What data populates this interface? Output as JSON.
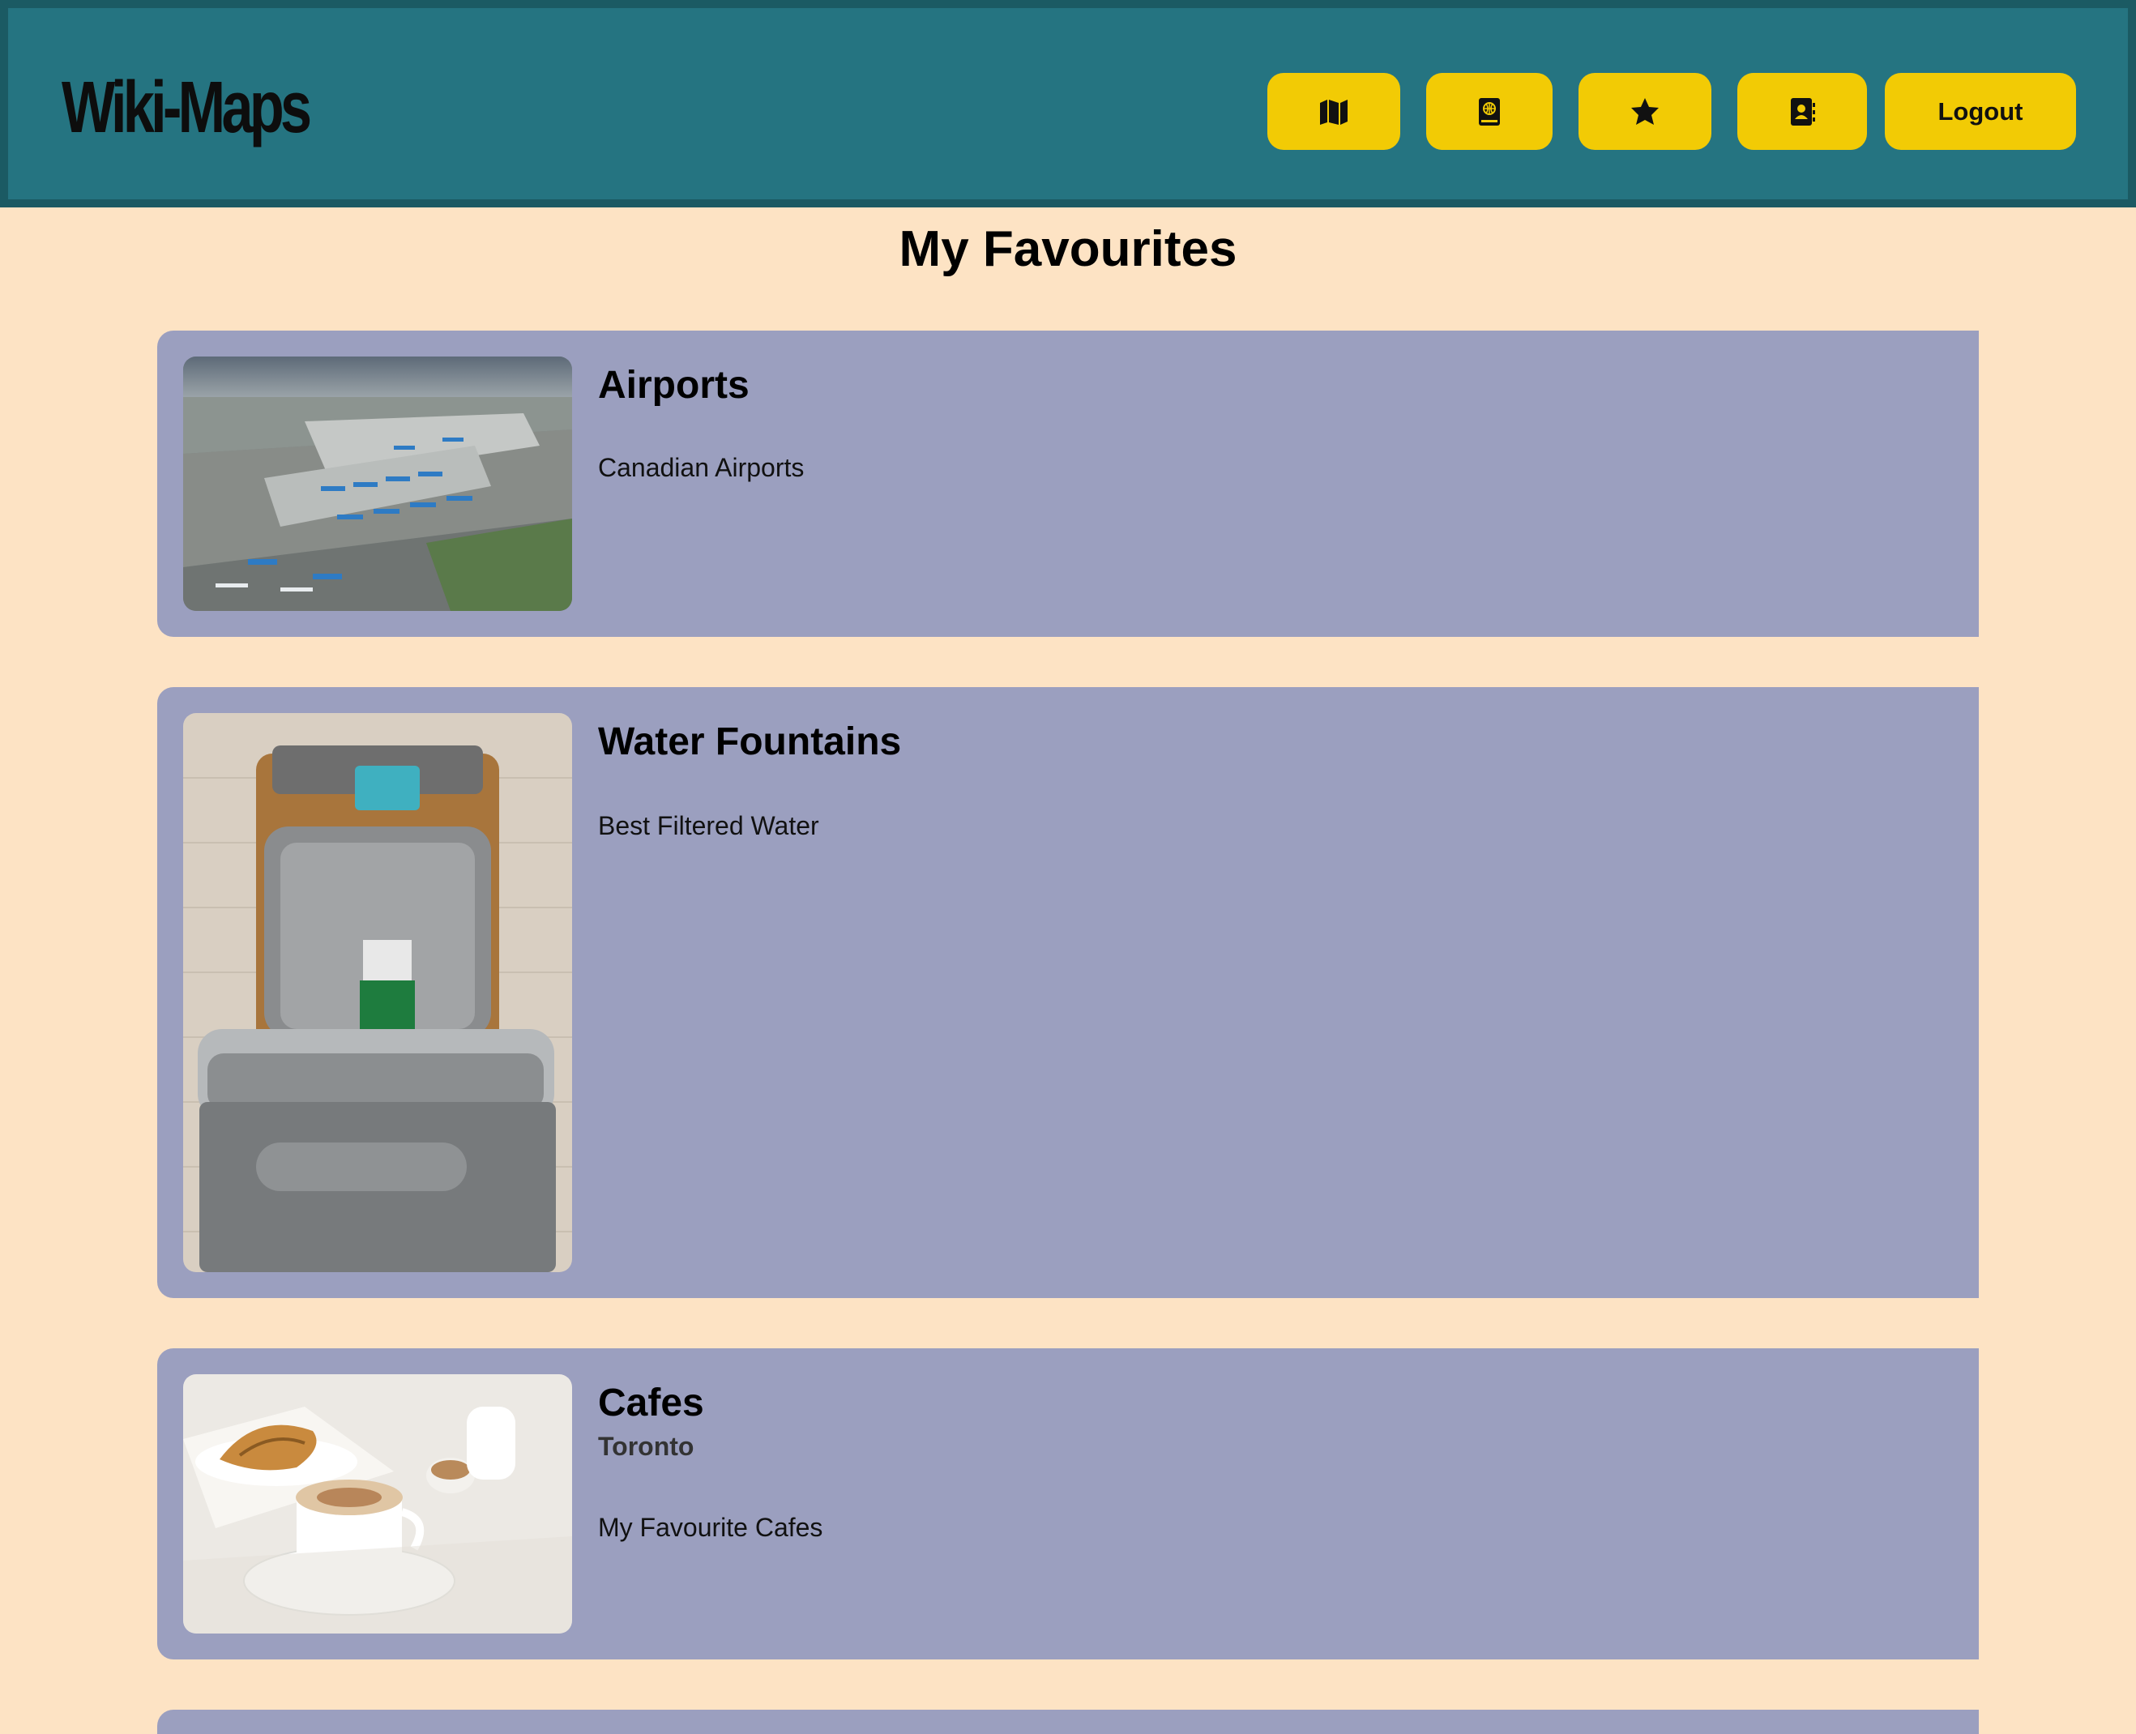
{
  "header": {
    "brand": "Wiki-Maps",
    "nav": [
      {
        "icon": "map-icon"
      },
      {
        "icon": "atlas-book-icon"
      },
      {
        "icon": "star-icon"
      },
      {
        "icon": "contact-book-icon"
      }
    ],
    "logout_label": "Logout"
  },
  "main": {
    "title": "My Favourites",
    "maps": [
      {
        "title": "Airports",
        "subtitle": "",
        "description": "Canadian Airports",
        "image": "airport-aerial-photo"
      },
      {
        "title": "Water Fountains",
        "subtitle": "",
        "description": "Best Filtered Water",
        "image": "water-fountain-photo"
      },
      {
        "title": "Cafes",
        "subtitle": "Toronto",
        "description": "My Favourite Cafes",
        "image": "cafe-coffee-croissant-photo"
      }
    ]
  },
  "colors": {
    "header_bg": "#257481",
    "button_bg": "#f2cb05",
    "page_bg": "#fde3c4",
    "card_bg": "#9b9fbf"
  }
}
